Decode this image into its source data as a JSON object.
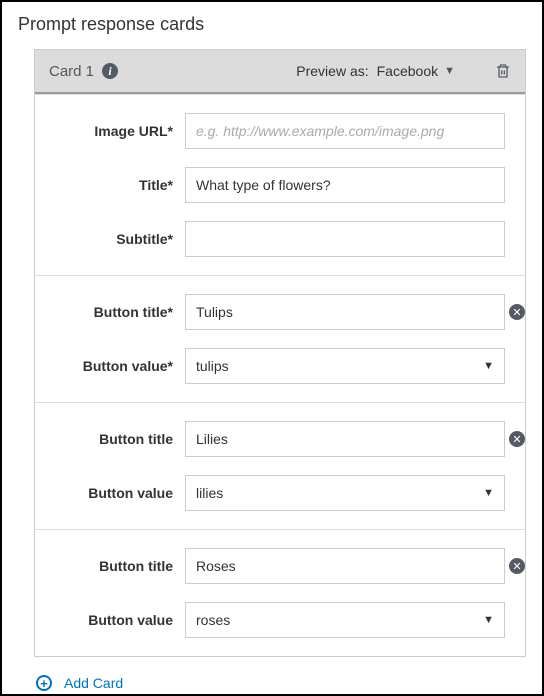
{
  "page_title": "Prompt response cards",
  "card": {
    "header_title": "Card 1",
    "preview_label": "Preview as:",
    "preview_value": "Facebook",
    "fields": {
      "image_url": {
        "label": "Image URL*",
        "value": "",
        "placeholder": "e.g. http://www.example.com/image.png"
      },
      "title": {
        "label": "Title*",
        "value": "What type of flowers?"
      },
      "subtitle": {
        "label": "Subtitle*",
        "value": ""
      }
    },
    "buttons": [
      {
        "title_label": "Button title*",
        "title_value": "Tulips",
        "value_label": "Button value*",
        "value_value": "tulips"
      },
      {
        "title_label": "Button title",
        "title_value": "Lilies",
        "value_label": "Button value",
        "value_value": "lilies"
      },
      {
        "title_label": "Button title",
        "title_value": "Roses",
        "value_label": "Button value",
        "value_value": "roses"
      }
    ]
  },
  "add_card_label": "Add Card"
}
